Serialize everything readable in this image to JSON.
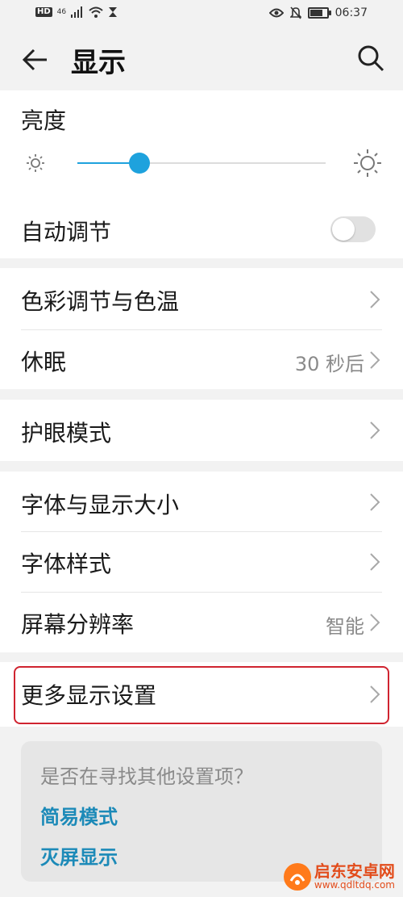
{
  "status_bar": {
    "hd": "HD",
    "network": "46",
    "time": "06:37",
    "battery_level": 0.85,
    "icons_left": [
      "hd-icon",
      "signal-icon",
      "wifi-icon",
      "hourglass-icon"
    ],
    "icons_right": [
      "eye-icon",
      "mute-icon",
      "battery-icon"
    ]
  },
  "header": {
    "title": "显示"
  },
  "brightness": {
    "label": "亮度",
    "level": 0.25,
    "accent": "#1ea2dd"
  },
  "auto_adjust": {
    "label": "自动调节",
    "enabled": false
  },
  "rows": {
    "color_temp": {
      "label": "色彩调节与色温"
    },
    "sleep": {
      "label": "休眠",
      "value": "30 秒后"
    },
    "eye_comfort": {
      "label": "护眼模式"
    },
    "font_size": {
      "label": "字体与显示大小"
    },
    "font_style": {
      "label": "字体样式"
    },
    "resolution": {
      "label": "屏幕分辨率",
      "value": "智能"
    },
    "more_display": {
      "label": "更多显示设置",
      "highlight_color": "#d02430"
    }
  },
  "suggestions": {
    "question": "是否在寻找其他设置项？",
    "links": [
      "简易模式",
      "灭屏显示"
    ],
    "link_color": "#1c8ab8"
  },
  "watermark": {
    "name": "启东安卓网",
    "url": "www.qdltdq.com"
  }
}
